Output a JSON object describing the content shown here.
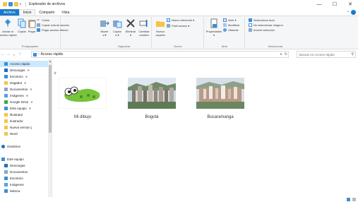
{
  "window": {
    "title": "Explorador de archivos",
    "controls": {
      "minimize": "—",
      "maximize": "☐",
      "close": "✕"
    }
  },
  "ribbon_tabs": [
    {
      "label": "Archivo",
      "kind": "file"
    },
    {
      "label": "Inicio",
      "kind": "active"
    },
    {
      "label": "Compartir",
      "kind": "normal"
    },
    {
      "label": "Vista",
      "kind": "normal"
    }
  ],
  "ribbon": {
    "portapapeles": {
      "label": "Portapapeles",
      "pin": "Anclar al\nAcceso rápido",
      "copy": "Copiar",
      "paste": "Pegar",
      "cut": "Cortar",
      "copy_path": "Copiar ruta de acceso",
      "paste_shortcut": "Pegar acceso directo"
    },
    "organizar": {
      "label": "Organizar",
      "move": "Mover\na ▾",
      "copy_to": "Copiar\na ▾",
      "delete": "Eliminar\n▾",
      "rename": "Cambiar\nnombre"
    },
    "nuevo": {
      "label": "Nuevo",
      "new_folder": "Nueva\ncarpeta",
      "new_item": "Nuevo elemento ▾",
      "easy_access": "Fácil acceso ▾"
    },
    "abrir": {
      "label": "Abrir",
      "properties": "Propiedades\n▾",
      "open": "Abrir ▾",
      "edit": "Modificar",
      "history": "Historial"
    },
    "seleccionar": {
      "label": "Seleccionar",
      "select_all": "Seleccionar todo",
      "select_none": "No seleccionar ninguno",
      "invert": "Invertir selección"
    }
  },
  "addressbar": {
    "path": "Acceso rápido",
    "search_placeholder": "Buscar en Acceso rápido",
    "nav": {
      "back": "←",
      "forward": "→",
      "recent": "∨",
      "up": "↑"
    },
    "dropdown": "∨",
    "refresh": "↻",
    "path_sep": "›",
    "search_glyph": "⚲"
  },
  "navpane": {
    "pin_glyph": "✱",
    "items": [
      {
        "label": "Acceso rápido",
        "icon": "star-icon",
        "selected": true,
        "pinned": false,
        "color": "#3a8fd8"
      },
      {
        "label": "Descargas",
        "icon": "download-icon",
        "selected": false,
        "pinned": true,
        "color": "#1f6fc5"
      },
      {
        "label": "Escritorio",
        "icon": "desktop-icon",
        "selected": false,
        "pinned": true,
        "color": "#3a8fd8"
      },
      {
        "label": "Dagabot",
        "icon": "folder-icon",
        "selected": false,
        "pinned": true,
        "color": "#f4c542"
      },
      {
        "label": "Documentos",
        "icon": "documents-icon",
        "selected": false,
        "pinned": true,
        "color": "#8aa6c8"
      },
      {
        "label": "Imágenes",
        "icon": "pictures-icon",
        "selected": false,
        "pinned": true,
        "color": "#5aa0e0"
      },
      {
        "label": "Google Drive",
        "icon": "google-drive-icon",
        "selected": false,
        "pinned": true,
        "color": "#34a853"
      },
      {
        "label": "Este equipo",
        "icon": "computer-icon",
        "selected": false,
        "pinned": true,
        "color": "#3a8fd8"
      },
      {
        "label": "Illustrator",
        "icon": "folder-icon",
        "selected": false,
        "pinned": false,
        "color": "#f4c542"
      },
      {
        "label": "Ilustrador",
        "icon": "folder-icon",
        "selected": false,
        "pinned": false,
        "color": "#f4c542"
      },
      {
        "label": "Nueva version j",
        "icon": "folder-icon",
        "selected": false,
        "pinned": false,
        "color": "#f4c542"
      },
      {
        "label": "Word",
        "icon": "folder-icon",
        "selected": false,
        "pinned": false,
        "color": "#f4c542"
      },
      {
        "label": "",
        "icon": "",
        "selected": false,
        "pinned": false,
        "color": ""
      },
      {
        "label": "OneDrive",
        "icon": "onedrive-icon",
        "selected": false,
        "pinned": false,
        "color": "#1f6fc5"
      },
      {
        "label": "",
        "icon": "",
        "selected": false,
        "pinned": false,
        "color": ""
      },
      {
        "label": "Este equipo",
        "icon": "computer-icon",
        "selected": false,
        "pinned": false,
        "color": "#3a8fd8"
      },
      {
        "label": "Descargas",
        "icon": "download-icon",
        "selected": false,
        "pinned": false,
        "color": "#1f6fc5"
      },
      {
        "label": "Documentos",
        "icon": "documents-icon",
        "selected": false,
        "pinned": false,
        "color": "#8aa6c8"
      },
      {
        "label": "Escritorio",
        "icon": "desktop-icon",
        "selected": false,
        "pinned": false,
        "color": "#3a8fd8"
      },
      {
        "label": "Imágenes",
        "icon": "pictures-icon",
        "selected": false,
        "pinned": false,
        "color": "#5aa0e0"
      },
      {
        "label": "Música",
        "icon": "music-icon",
        "selected": false,
        "pinned": false,
        "color": "#3a8fd8"
      }
    ]
  },
  "content": {
    "section_chevron": "∨",
    "files": [
      {
        "name": "Mi dibujo",
        "kind": "drawing"
      },
      {
        "name": "Bogotá",
        "kind": "city"
      },
      {
        "name": "Bucaramanga",
        "kind": "city2"
      }
    ]
  },
  "colors": {
    "accent": "#1979ca",
    "selection": "#cce8ff",
    "ribbon_bg": "#f5f6f7"
  }
}
